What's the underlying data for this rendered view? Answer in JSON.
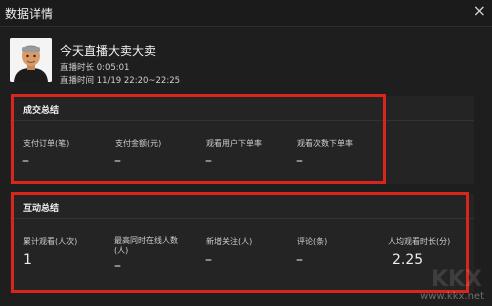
{
  "window": {
    "title": "数据详情",
    "close_glyph": "×"
  },
  "stream": {
    "title": "今天直播大卖大卖",
    "duration": "直播时长 0:05:01",
    "time": "直播时间 11/19 22:20~22:25"
  },
  "sales_summary": {
    "title": "成交总结",
    "metrics": [
      {
        "label": "支付订单(笔)",
        "value": "–"
      },
      {
        "label": "支付金额(元)",
        "value": "–"
      },
      {
        "label": "观看用户下单率",
        "value": "–"
      },
      {
        "label": "观看次数下单率",
        "value": "–"
      }
    ]
  },
  "interaction_summary": {
    "title": "互动总结",
    "metrics": [
      {
        "label": "累计观看(人次)",
        "value": "1"
      },
      {
        "label": "最高同时在线人数(人)",
        "value": "–"
      },
      {
        "label": "新增关注(人)",
        "value": "–"
      },
      {
        "label": "评论(条)",
        "value": "–"
      },
      {
        "label": "人均观看时长(分)",
        "value": "2.25"
      }
    ]
  },
  "watermark": {
    "text": "www.kkx.net",
    "logo": "KKX"
  },
  "colors": {
    "highlight": "#d9261c",
    "background": "#1e1e1f",
    "panel": "#242425"
  }
}
